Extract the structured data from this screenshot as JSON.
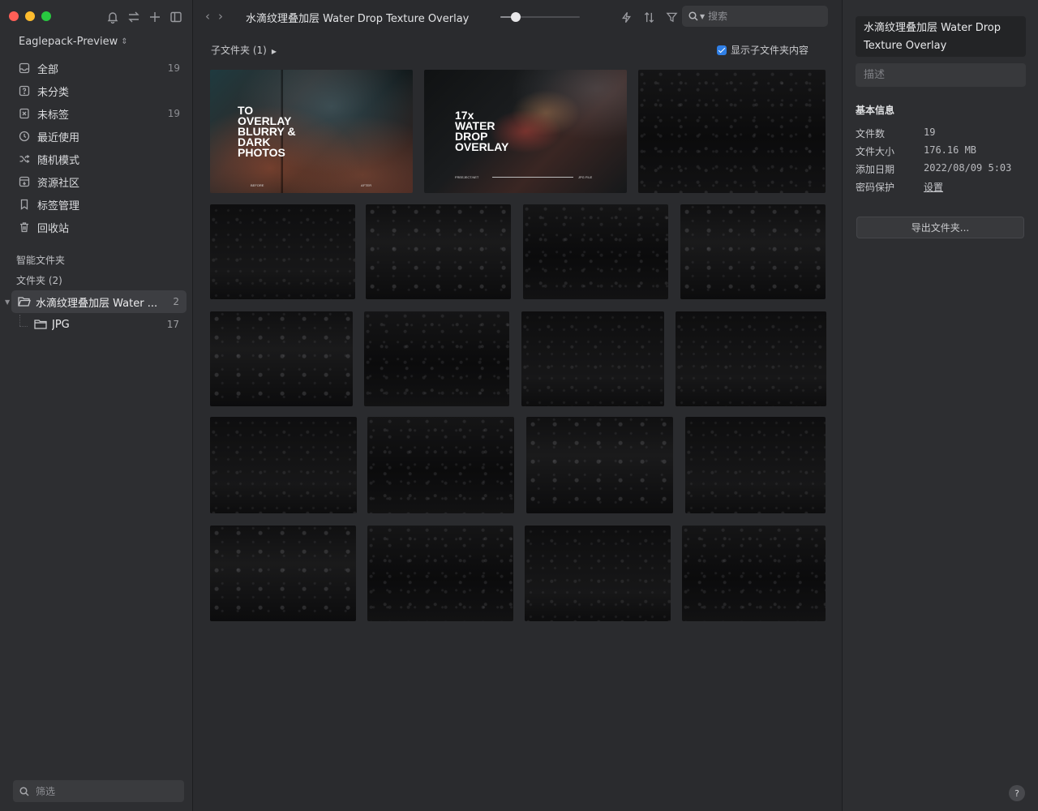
{
  "window": {
    "title": "水滴纹理叠加层 Water Drop Texture Overlay"
  },
  "sidebar": {
    "library_name": "Eaglepack-Preview",
    "nav_items": [
      {
        "label": "全部",
        "count": "19",
        "icon": "inbox-icon"
      },
      {
        "label": "未分类",
        "count": "",
        "icon": "question-box-icon"
      },
      {
        "label": "未标签",
        "count": "19",
        "icon": "untagged-icon"
      },
      {
        "label": "最近使用",
        "count": "",
        "icon": "clock-icon"
      },
      {
        "label": "随机模式",
        "count": "",
        "icon": "shuffle-icon"
      },
      {
        "label": "资源社区",
        "count": "",
        "icon": "download-box-icon"
      },
      {
        "label": "标签管理",
        "count": "",
        "icon": "bookmark-icon"
      },
      {
        "label": "回收站",
        "count": "",
        "icon": "trash-icon"
      }
    ],
    "smart_folders_header": "智能文件夹",
    "folders_header": "文件夹 (2)",
    "folders": [
      {
        "label": "水滴纹理叠加层 Water ...",
        "count": "2"
      },
      {
        "label": "JPG",
        "count": "17"
      }
    ],
    "filter_placeholder": "筛选"
  },
  "toolbar": {
    "title": "水滴纹理叠加层 Water Drop Texture Overlay",
    "zoom_level": 0.15,
    "search_placeholder": "搜索"
  },
  "content": {
    "subfolder_header": "子文件夹 (1)",
    "show_subfolder_label": "显示子文件夹内容",
    "show_subfolder_checked": true,
    "promo1": {
      "lines": [
        "TO",
        "OVERLAY",
        "BLURRY &",
        "DARK",
        "PHOTOS"
      ],
      "left_caption": "BEFORE",
      "right_caption": "AFTER"
    },
    "promo2": {
      "lines": [
        "17x",
        "WATER",
        "DROP",
        "OVERLAY"
      ],
      "left_caption": "FREEJECT.NET",
      "right_caption": "JPG FILE"
    }
  },
  "inspector": {
    "title": "水滴纹理叠加层 Water Drop Texture Overlay",
    "description_placeholder": "描述",
    "section_header": "基本信息",
    "rows": [
      {
        "key": "文件数",
        "value": "19"
      },
      {
        "key": "文件大小",
        "value": "176.16 MB"
      },
      {
        "key": "添加日期",
        "value": "2022/08/09 5:03"
      },
      {
        "key": "密码保护",
        "value": "设置"
      }
    ],
    "export_label": "导出文件夹...",
    "help_label": "?"
  }
}
